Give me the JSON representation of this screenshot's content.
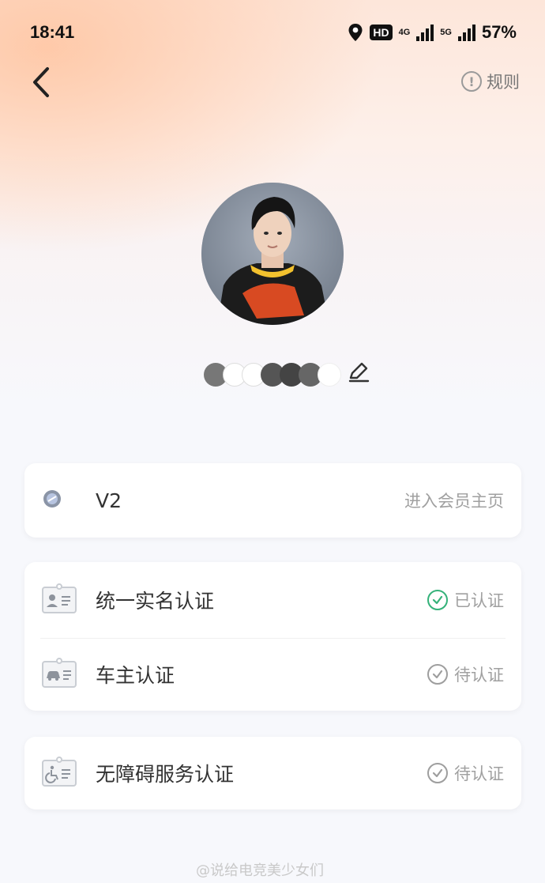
{
  "status_bar": {
    "time": "18:41",
    "hd_label": "HD",
    "network_1": "4G",
    "network_2": "5G",
    "battery": "57%"
  },
  "nav": {
    "back_icon": "chevron-left-icon",
    "rules_icon": "exclamation-circle-icon",
    "rules_label": "规则"
  },
  "profile": {
    "avatar_icon": "user-avatar",
    "username_obscured": true
  },
  "membership": {
    "level": "V2",
    "action_label": "进入会员主页",
    "badge_color": "#8a94a6"
  },
  "verifications": [
    {
      "label": "统一实名认证",
      "status": "已认证",
      "verified": true,
      "icon": "id-card-person-icon"
    },
    {
      "label": "车主认证",
      "status": "待认证",
      "verified": false,
      "icon": "id-card-car-icon"
    }
  ],
  "accessibility": {
    "label": "无障碍服务认证",
    "status": "待认证",
    "verified": false,
    "icon": "id-card-wheelchair-icon"
  },
  "colors": {
    "verified_green": "#35b27a",
    "pending_gray": "#9e9e9e",
    "header_peach": "#fde6da"
  },
  "watermark": "@说给电竞美少女们"
}
